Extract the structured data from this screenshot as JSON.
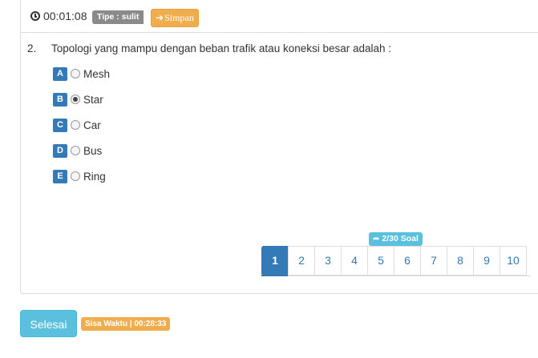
{
  "header": {
    "timer": "00:01:08",
    "type_badge": "Tipe : sulit",
    "save_label": "Simpan"
  },
  "question": {
    "number": "2.",
    "text": "Topologi yang mampu dengan beban trafik atau koneksi besar adalah :",
    "selected": "B",
    "options": [
      {
        "letter": "A",
        "label": "Mesh"
      },
      {
        "letter": "B",
        "label": "Star"
      },
      {
        "letter": "C",
        "label": "Car"
      },
      {
        "letter": "D",
        "label": "Bus"
      },
      {
        "letter": "E",
        "label": "Ring"
      }
    ]
  },
  "navigation": {
    "progress_badge": "2/30 Soal",
    "current_page": "1",
    "pages": [
      "1",
      "2",
      "3",
      "4",
      "5",
      "6",
      "7",
      "8",
      "9",
      "10"
    ]
  },
  "footer": {
    "finish_label": "Selesai",
    "remaining_time": "Sisa Waktu | 00:28:33"
  },
  "colors": {
    "primary": "#337ab7",
    "info": "#5bc0de",
    "warning": "#f0ad4e",
    "muted": "#8a8a8a"
  }
}
